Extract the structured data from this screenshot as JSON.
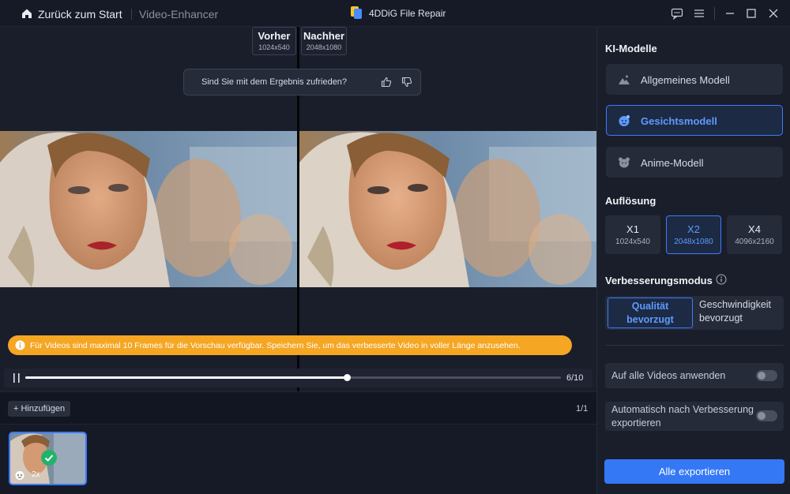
{
  "titlebar": {
    "back_label": "Zurück zum Start",
    "breadcrumb": "Video-Enhancer",
    "app_title": "4DDiG File Repair",
    "controls": [
      "feedback-icon",
      "menu-icon",
      "minimize-icon",
      "maximize-icon",
      "close-icon"
    ]
  },
  "preview": {
    "before": {
      "label": "Vorher",
      "resolution": "1024x540"
    },
    "after": {
      "label": "Nachher",
      "resolution": "2048x1080"
    },
    "feedback_question": "Sind Sie mit dem Ergebnis zufrieden?",
    "notice": "Für Videos sind maximal 10 Frames für die Vorschau verfügbar. Speichern Sie, um das verbesserte Video in voller Länge anzusehen.",
    "frame_counter": "6/10",
    "progress_fraction": 0.6
  },
  "strip": {
    "add_label": "Hinzufügen",
    "page_counter": "1/1",
    "thumb_scale": "2x"
  },
  "sidebar": {
    "models_title": "KI-Modelle",
    "models": [
      {
        "label": "Allgemeines Modell",
        "icon": "landscape-icon",
        "active": false
      },
      {
        "label": "Gesichtsmodell",
        "icon": "face-icon",
        "active": true
      },
      {
        "label": "Anime-Modell",
        "icon": "anime-icon",
        "active": false
      }
    ],
    "resolution_title": "Auflösung",
    "resolutions": [
      {
        "label": "X1",
        "size": "1024x540",
        "active": false
      },
      {
        "label": "X2",
        "size": "2048x1080",
        "active": true
      },
      {
        "label": "X4",
        "size": "4096x2160",
        "active": false
      }
    ],
    "mode_title": "Verbesserungsmodus",
    "mode_quality": "Qualität bevorzugt",
    "mode_speed": "Geschwindigkeit bevorzugt",
    "apply_all_label": "Auf alle Videos anwenden",
    "auto_export_label": "Automatisch nach Verbesserung exportieren",
    "export_label": "Alle exportieren"
  },
  "colors": {
    "accent": "#3478f6",
    "notice": "#f5a623",
    "success": "#22b36b"
  }
}
